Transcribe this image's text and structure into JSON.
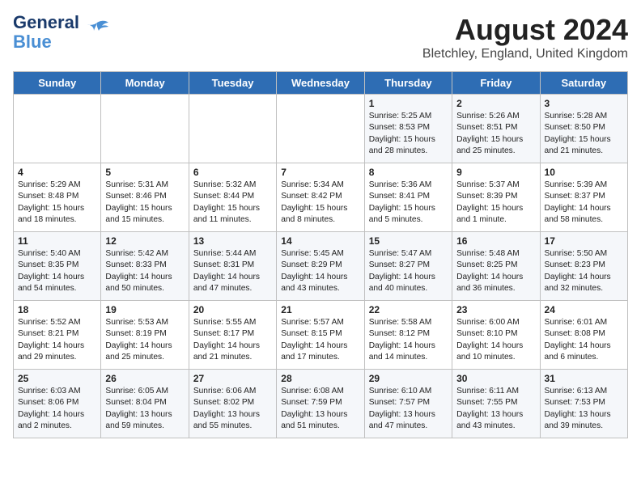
{
  "header": {
    "logo_line1": "General",
    "logo_line2": "Blue",
    "main_title": "August 2024",
    "subtitle": "Bletchley, England, United Kingdom"
  },
  "days_of_week": [
    "Sunday",
    "Monday",
    "Tuesday",
    "Wednesday",
    "Thursday",
    "Friday",
    "Saturday"
  ],
  "weeks": [
    [
      {
        "day": "",
        "content": ""
      },
      {
        "day": "",
        "content": ""
      },
      {
        "day": "",
        "content": ""
      },
      {
        "day": "",
        "content": ""
      },
      {
        "day": "1",
        "content": "Sunrise: 5:25 AM\nSunset: 8:53 PM\nDaylight: 15 hours\nand 28 minutes."
      },
      {
        "day": "2",
        "content": "Sunrise: 5:26 AM\nSunset: 8:51 PM\nDaylight: 15 hours\nand 25 minutes."
      },
      {
        "day": "3",
        "content": "Sunrise: 5:28 AM\nSunset: 8:50 PM\nDaylight: 15 hours\nand 21 minutes."
      }
    ],
    [
      {
        "day": "4",
        "content": "Sunrise: 5:29 AM\nSunset: 8:48 PM\nDaylight: 15 hours\nand 18 minutes."
      },
      {
        "day": "5",
        "content": "Sunrise: 5:31 AM\nSunset: 8:46 PM\nDaylight: 15 hours\nand 15 minutes."
      },
      {
        "day": "6",
        "content": "Sunrise: 5:32 AM\nSunset: 8:44 PM\nDaylight: 15 hours\nand 11 minutes."
      },
      {
        "day": "7",
        "content": "Sunrise: 5:34 AM\nSunset: 8:42 PM\nDaylight: 15 hours\nand 8 minutes."
      },
      {
        "day": "8",
        "content": "Sunrise: 5:36 AM\nSunset: 8:41 PM\nDaylight: 15 hours\nand 5 minutes."
      },
      {
        "day": "9",
        "content": "Sunrise: 5:37 AM\nSunset: 8:39 PM\nDaylight: 15 hours\nand 1 minute."
      },
      {
        "day": "10",
        "content": "Sunrise: 5:39 AM\nSunset: 8:37 PM\nDaylight: 14 hours\nand 58 minutes."
      }
    ],
    [
      {
        "day": "11",
        "content": "Sunrise: 5:40 AM\nSunset: 8:35 PM\nDaylight: 14 hours\nand 54 minutes."
      },
      {
        "day": "12",
        "content": "Sunrise: 5:42 AM\nSunset: 8:33 PM\nDaylight: 14 hours\nand 50 minutes."
      },
      {
        "day": "13",
        "content": "Sunrise: 5:44 AM\nSunset: 8:31 PM\nDaylight: 14 hours\nand 47 minutes."
      },
      {
        "day": "14",
        "content": "Sunrise: 5:45 AM\nSunset: 8:29 PM\nDaylight: 14 hours\nand 43 minutes."
      },
      {
        "day": "15",
        "content": "Sunrise: 5:47 AM\nSunset: 8:27 PM\nDaylight: 14 hours\nand 40 minutes."
      },
      {
        "day": "16",
        "content": "Sunrise: 5:48 AM\nSunset: 8:25 PM\nDaylight: 14 hours\nand 36 minutes."
      },
      {
        "day": "17",
        "content": "Sunrise: 5:50 AM\nSunset: 8:23 PM\nDaylight: 14 hours\nand 32 minutes."
      }
    ],
    [
      {
        "day": "18",
        "content": "Sunrise: 5:52 AM\nSunset: 8:21 PM\nDaylight: 14 hours\nand 29 minutes."
      },
      {
        "day": "19",
        "content": "Sunrise: 5:53 AM\nSunset: 8:19 PM\nDaylight: 14 hours\nand 25 minutes."
      },
      {
        "day": "20",
        "content": "Sunrise: 5:55 AM\nSunset: 8:17 PM\nDaylight: 14 hours\nand 21 minutes."
      },
      {
        "day": "21",
        "content": "Sunrise: 5:57 AM\nSunset: 8:15 PM\nDaylight: 14 hours\nand 17 minutes."
      },
      {
        "day": "22",
        "content": "Sunrise: 5:58 AM\nSunset: 8:12 PM\nDaylight: 14 hours\nand 14 minutes."
      },
      {
        "day": "23",
        "content": "Sunrise: 6:00 AM\nSunset: 8:10 PM\nDaylight: 14 hours\nand 10 minutes."
      },
      {
        "day": "24",
        "content": "Sunrise: 6:01 AM\nSunset: 8:08 PM\nDaylight: 14 hours\nand 6 minutes."
      }
    ],
    [
      {
        "day": "25",
        "content": "Sunrise: 6:03 AM\nSunset: 8:06 PM\nDaylight: 14 hours\nand 2 minutes."
      },
      {
        "day": "26",
        "content": "Sunrise: 6:05 AM\nSunset: 8:04 PM\nDaylight: 13 hours\nand 59 minutes."
      },
      {
        "day": "27",
        "content": "Sunrise: 6:06 AM\nSunset: 8:02 PM\nDaylight: 13 hours\nand 55 minutes."
      },
      {
        "day": "28",
        "content": "Sunrise: 6:08 AM\nSunset: 7:59 PM\nDaylight: 13 hours\nand 51 minutes."
      },
      {
        "day": "29",
        "content": "Sunrise: 6:10 AM\nSunset: 7:57 PM\nDaylight: 13 hours\nand 47 minutes."
      },
      {
        "day": "30",
        "content": "Sunrise: 6:11 AM\nSunset: 7:55 PM\nDaylight: 13 hours\nand 43 minutes."
      },
      {
        "day": "31",
        "content": "Sunrise: 6:13 AM\nSunset: 7:53 PM\nDaylight: 13 hours\nand 39 minutes."
      }
    ]
  ]
}
